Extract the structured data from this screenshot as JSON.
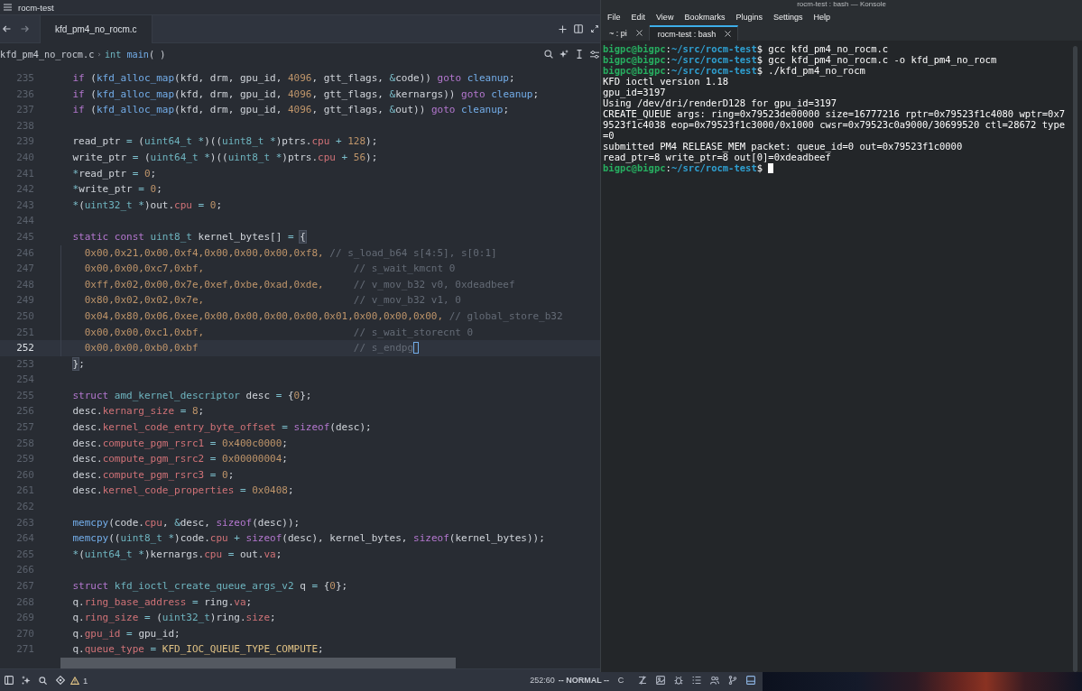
{
  "editor": {
    "title": "rocm-test",
    "tabs": [
      {
        "label": "kfd_pm4_no_rocm.c",
        "selected": true
      }
    ],
    "breadcrumb": {
      "file": "kfd_pm4_no_rocm.c",
      "separator": "›",
      "symbol": [
        {
          "kind": "type",
          "text": "int"
        },
        {
          "kind": "function",
          "text": " main"
        },
        {
          "kind": "plain",
          "text": "( )"
        }
      ]
    },
    "lines": [
      {
        "number": "235",
        "current": false,
        "tokens": [
          {
            "kind": "keyword",
            "text": "    if"
          },
          {
            "kind": "plain",
            "text": " ("
          },
          {
            "kind": "function",
            "text": "kfd_alloc_map"
          },
          {
            "kind": "plain",
            "text": "(kfd, drm, gpu_id, "
          },
          {
            "kind": "number",
            "text": "4096"
          },
          {
            "kind": "plain",
            "text": ", gtt_flags, "
          },
          {
            "kind": "operator",
            "text": "&"
          },
          {
            "kind": "plain",
            "text": "code)) "
          },
          {
            "kind": "keyword",
            "text": "goto"
          },
          {
            "kind": "function",
            "text": " cleanup"
          },
          {
            "kind": "plain",
            "text": ";"
          }
        ]
      },
      {
        "number": "236",
        "current": false,
        "tokens": [
          {
            "kind": "keyword",
            "text": "    if"
          },
          {
            "kind": "plain",
            "text": " ("
          },
          {
            "kind": "function",
            "text": "kfd_alloc_map"
          },
          {
            "kind": "plain",
            "text": "(kfd, drm, gpu_id, "
          },
          {
            "kind": "number",
            "text": "4096"
          },
          {
            "kind": "plain",
            "text": ", gtt_flags, "
          },
          {
            "kind": "operator",
            "text": "&"
          },
          {
            "kind": "plain",
            "text": "kernargs)) "
          },
          {
            "kind": "keyword",
            "text": "goto"
          },
          {
            "kind": "function",
            "text": " cleanup"
          },
          {
            "kind": "plain",
            "text": ";"
          }
        ]
      },
      {
        "number": "237",
        "current": false,
        "tokens": [
          {
            "kind": "keyword",
            "text": "    if"
          },
          {
            "kind": "plain",
            "text": " ("
          },
          {
            "kind": "function",
            "text": "kfd_alloc_map"
          },
          {
            "kind": "plain",
            "text": "(kfd, drm, gpu_id, "
          },
          {
            "kind": "number",
            "text": "4096"
          },
          {
            "kind": "plain",
            "text": ", gtt_flags, "
          },
          {
            "kind": "operator",
            "text": "&"
          },
          {
            "kind": "plain",
            "text": "out)) "
          },
          {
            "kind": "keyword",
            "text": "goto"
          },
          {
            "kind": "function",
            "text": " cleanup"
          },
          {
            "kind": "plain",
            "text": ";"
          }
        ]
      },
      {
        "number": "238",
        "current": false
      },
      {
        "number": "239",
        "current": false,
        "tokens": [
          {
            "kind": "plain",
            "text": "    read_ptr"
          },
          {
            "kind": "operator",
            "text": " = "
          },
          {
            "kind": "plain",
            "text": "("
          },
          {
            "kind": "type",
            "text": "uint64_t"
          },
          {
            "kind": "operator",
            "text": " *"
          },
          {
            "kind": "plain",
            "text": ")(("
          },
          {
            "kind": "type",
            "text": "uint8_t"
          },
          {
            "kind": "operator",
            "text": " *"
          },
          {
            "kind": "plain",
            "text": ")ptrs."
          },
          {
            "kind": "field",
            "text": "cpu"
          },
          {
            "kind": "operator",
            "text": " + "
          },
          {
            "kind": "number",
            "text": "128"
          },
          {
            "kind": "plain",
            "text": ");"
          }
        ]
      },
      {
        "number": "240",
        "current": false,
        "tokens": [
          {
            "kind": "plain",
            "text": "    write_ptr"
          },
          {
            "kind": "operator",
            "text": " = "
          },
          {
            "kind": "plain",
            "text": "("
          },
          {
            "kind": "type",
            "text": "uint64_t"
          },
          {
            "kind": "operator",
            "text": " *"
          },
          {
            "kind": "plain",
            "text": ")(("
          },
          {
            "kind": "type",
            "text": "uint8_t"
          },
          {
            "kind": "operator",
            "text": " *"
          },
          {
            "kind": "plain",
            "text": ")ptrs."
          },
          {
            "kind": "field",
            "text": "cpu"
          },
          {
            "kind": "operator",
            "text": " + "
          },
          {
            "kind": "number",
            "text": "56"
          },
          {
            "kind": "plain",
            "text": ");"
          }
        ]
      },
      {
        "number": "241",
        "current": false,
        "tokens": [
          {
            "kind": "operator",
            "text": "    *"
          },
          {
            "kind": "plain",
            "text": "read_ptr"
          },
          {
            "kind": "operator",
            "text": " = "
          },
          {
            "kind": "number",
            "text": "0"
          },
          {
            "kind": "plain",
            "text": ";"
          }
        ]
      },
      {
        "number": "242",
        "current": false,
        "tokens": [
          {
            "kind": "operator",
            "text": "    *"
          },
          {
            "kind": "plain",
            "text": "write_ptr"
          },
          {
            "kind": "operator",
            "text": " = "
          },
          {
            "kind": "number",
            "text": "0"
          },
          {
            "kind": "plain",
            "text": ";"
          }
        ]
      },
      {
        "number": "243",
        "current": false,
        "tokens": [
          {
            "kind": "operator",
            "text": "    *"
          },
          {
            "kind": "plain",
            "text": "("
          },
          {
            "kind": "type",
            "text": "uint32_t"
          },
          {
            "kind": "operator",
            "text": " *"
          },
          {
            "kind": "plain",
            "text": ")out."
          },
          {
            "kind": "field",
            "text": "cpu"
          },
          {
            "kind": "operator",
            "text": " = "
          },
          {
            "kind": "number",
            "text": "0"
          },
          {
            "kind": "plain",
            "text": ";"
          }
        ]
      },
      {
        "number": "244",
        "current": false
      },
      {
        "number": "245",
        "current": false,
        "tokens": [
          {
            "kind": "keyword",
            "text": "    static const"
          },
          {
            "kind": "type",
            "text": " uint8_t"
          },
          {
            "kind": "plain",
            "text": " kernel_bytes[]"
          },
          {
            "kind": "operator",
            "text": " = "
          },
          {
            "kind": "bracket",
            "text": "{"
          }
        ]
      },
      {
        "number": "246",
        "current": false,
        "tokens": [
          {
            "kind": "number",
            "text": "      0x00,0x21,0x00,0xf4,0x00,0x00,0x00,0xf8,"
          },
          {
            "kind": "comment",
            "text": " // s_load_b64 s[4:5], s[0:1]"
          }
        ]
      },
      {
        "number": "247",
        "current": false,
        "tokens": [
          {
            "kind": "number",
            "text": "      0x00,0x00,0xc7,0xbf,"
          },
          {
            "kind": "comment",
            "text": "                         // s_wait_kmcnt 0"
          }
        ]
      },
      {
        "number": "248",
        "current": false,
        "tokens": [
          {
            "kind": "number",
            "text": "      0xff,0x02,0x00,0x7e,0xef,0xbe,0xad,0xde,"
          },
          {
            "kind": "comment",
            "text": "     // v_mov_b32 v0, 0xdeadbeef"
          }
        ]
      },
      {
        "number": "249",
        "current": false,
        "tokens": [
          {
            "kind": "number",
            "text": "      0x80,0x02,0x02,0x7e,"
          },
          {
            "kind": "comment",
            "text": "                         // v_mov_b32 v1, 0"
          }
        ]
      },
      {
        "number": "250",
        "current": false,
        "tokens": [
          {
            "kind": "number",
            "text": "      0x04,0x80,0x06,0xee,0x00,0x00,0x00,0x00,0x01,0x00,0x00,0x00,"
          },
          {
            "kind": "comment",
            "text": " // global_store_b32"
          }
        ]
      },
      {
        "number": "251",
        "current": false,
        "tokens": [
          {
            "kind": "number",
            "text": "      0x00,0x00,0xc1,0xbf,"
          },
          {
            "kind": "comment",
            "text": "                         // s_wait_storecnt 0"
          }
        ]
      },
      {
        "number": "252",
        "current": true,
        "tokens": [
          {
            "kind": "number",
            "text": "      0x00,0x00,0xb0,0xbf"
          },
          {
            "kind": "comment",
            "text": "                          // s_endpg"
          }
        ]
      },
      {
        "number": "253",
        "current": false,
        "tokens": [
          {
            "kind": "bracket",
            "text": "    }"
          },
          {
            "kind": "plain",
            "text": ";"
          }
        ]
      },
      {
        "number": "254",
        "current": false
      },
      {
        "number": "255",
        "current": false,
        "tokens": [
          {
            "kind": "keyword",
            "text": "    struct"
          },
          {
            "kind": "type",
            "text": " amd_kernel_descriptor"
          },
          {
            "kind": "plain",
            "text": " desc"
          },
          {
            "kind": "operator",
            "text": " = "
          },
          {
            "kind": "plain",
            "text": "{"
          },
          {
            "kind": "number",
            "text": "0"
          },
          {
            "kind": "plain",
            "text": "};"
          }
        ]
      },
      {
        "number": "256",
        "current": false,
        "tokens": [
          {
            "kind": "plain",
            "text": "    desc."
          },
          {
            "kind": "field",
            "text": "kernarg_size"
          },
          {
            "kind": "operator",
            "text": " = "
          },
          {
            "kind": "number",
            "text": "8"
          },
          {
            "kind": "plain",
            "text": ";"
          }
        ]
      },
      {
        "number": "257",
        "current": false,
        "tokens": [
          {
            "kind": "plain",
            "text": "    desc."
          },
          {
            "kind": "field",
            "text": "kernel_code_entry_byte_offset"
          },
          {
            "kind": "operator",
            "text": " = "
          },
          {
            "kind": "keyword",
            "text": "sizeof"
          },
          {
            "kind": "plain",
            "text": "(desc);"
          }
        ]
      },
      {
        "number": "258",
        "current": false,
        "tokens": [
          {
            "kind": "plain",
            "text": "    desc."
          },
          {
            "kind": "field",
            "text": "compute_pgm_rsrc1"
          },
          {
            "kind": "operator",
            "text": " = "
          },
          {
            "kind": "number",
            "text": "0x400c0000"
          },
          {
            "kind": "plain",
            "text": ";"
          }
        ]
      },
      {
        "number": "259",
        "current": false,
        "tokens": [
          {
            "kind": "plain",
            "text": "    desc."
          },
          {
            "kind": "field",
            "text": "compute_pgm_rsrc2"
          },
          {
            "kind": "operator",
            "text": " = "
          },
          {
            "kind": "number",
            "text": "0x00000004"
          },
          {
            "kind": "plain",
            "text": ";"
          }
        ]
      },
      {
        "number": "260",
        "current": false,
        "tokens": [
          {
            "kind": "plain",
            "text": "    desc."
          },
          {
            "kind": "field",
            "text": "compute_pgm_rsrc3"
          },
          {
            "kind": "operator",
            "text": " = "
          },
          {
            "kind": "number",
            "text": "0"
          },
          {
            "kind": "plain",
            "text": ";"
          }
        ]
      },
      {
        "number": "261",
        "current": false,
        "tokens": [
          {
            "kind": "plain",
            "text": "    desc."
          },
          {
            "kind": "field",
            "text": "kernel_code_properties"
          },
          {
            "kind": "operator",
            "text": " = "
          },
          {
            "kind": "number",
            "text": "0x0408"
          },
          {
            "kind": "plain",
            "text": ";"
          }
        ]
      },
      {
        "number": "262",
        "current": false
      },
      {
        "number": "263",
        "current": false,
        "tokens": [
          {
            "kind": "function",
            "text": "    memcpy"
          },
          {
            "kind": "plain",
            "text": "(code."
          },
          {
            "kind": "field",
            "text": "cpu"
          },
          {
            "kind": "plain",
            "text": ", "
          },
          {
            "kind": "operator",
            "text": "&"
          },
          {
            "kind": "plain",
            "text": "desc, "
          },
          {
            "kind": "keyword",
            "text": "sizeof"
          },
          {
            "kind": "plain",
            "text": "(desc));"
          }
        ]
      },
      {
        "number": "264",
        "current": false,
        "tokens": [
          {
            "kind": "function",
            "text": "    memcpy"
          },
          {
            "kind": "plain",
            "text": "(("
          },
          {
            "kind": "type",
            "text": "uint8_t"
          },
          {
            "kind": "operator",
            "text": " *"
          },
          {
            "kind": "plain",
            "text": ")code."
          },
          {
            "kind": "field",
            "text": "cpu"
          },
          {
            "kind": "operator",
            "text": " + "
          },
          {
            "kind": "keyword",
            "text": "sizeof"
          },
          {
            "kind": "plain",
            "text": "(desc), kernel_bytes, "
          },
          {
            "kind": "keyword",
            "text": "sizeof"
          },
          {
            "kind": "plain",
            "text": "(kernel_bytes));"
          }
        ]
      },
      {
        "number": "265",
        "current": false,
        "tokens": [
          {
            "kind": "operator",
            "text": "    *"
          },
          {
            "kind": "plain",
            "text": "("
          },
          {
            "kind": "type",
            "text": "uint64_t"
          },
          {
            "kind": "operator",
            "text": " *"
          },
          {
            "kind": "plain",
            "text": ")kernargs."
          },
          {
            "kind": "field",
            "text": "cpu"
          },
          {
            "kind": "operator",
            "text": " = "
          },
          {
            "kind": "plain",
            "text": "out."
          },
          {
            "kind": "field",
            "text": "va"
          },
          {
            "kind": "plain",
            "text": ";"
          }
        ]
      },
      {
        "number": "266",
        "current": false
      },
      {
        "number": "267",
        "current": false,
        "tokens": [
          {
            "kind": "keyword",
            "text": "    struct"
          },
          {
            "kind": "type",
            "text": " kfd_ioctl_create_queue_args_v2"
          },
          {
            "kind": "plain",
            "text": " q"
          },
          {
            "kind": "operator",
            "text": " = "
          },
          {
            "kind": "plain",
            "text": "{"
          },
          {
            "kind": "number",
            "text": "0"
          },
          {
            "kind": "plain",
            "text": "};"
          }
        ]
      },
      {
        "number": "268",
        "current": false,
        "tokens": [
          {
            "kind": "plain",
            "text": "    q."
          },
          {
            "kind": "field",
            "text": "ring_base_address"
          },
          {
            "kind": "operator",
            "text": " = "
          },
          {
            "kind": "plain",
            "text": "ring."
          },
          {
            "kind": "field",
            "text": "va"
          },
          {
            "kind": "plain",
            "text": ";"
          }
        ]
      },
      {
        "number": "269",
        "current": false,
        "tokens": [
          {
            "kind": "plain",
            "text": "    q."
          },
          {
            "kind": "field",
            "text": "ring_size"
          },
          {
            "kind": "operator",
            "text": " = "
          },
          {
            "kind": "plain",
            "text": "("
          },
          {
            "kind": "type",
            "text": "uint32_t"
          },
          {
            "kind": "plain",
            "text": ")ring."
          },
          {
            "kind": "field",
            "text": "size"
          },
          {
            "kind": "plain",
            "text": ";"
          }
        ]
      },
      {
        "number": "270",
        "current": false,
        "tokens": [
          {
            "kind": "plain",
            "text": "    q."
          },
          {
            "kind": "field",
            "text": "gpu_id"
          },
          {
            "kind": "operator",
            "text": " = "
          },
          {
            "kind": "plain",
            "text": "gpu_id;"
          }
        ]
      },
      {
        "number": "271",
        "current": false,
        "tokens": [
          {
            "kind": "plain",
            "text": "    q."
          },
          {
            "kind": "field",
            "text": "queue_type"
          },
          {
            "kind": "operator",
            "text": " = "
          },
          {
            "kind": "constant",
            "text": "KFD_IOC_QUEUE_TYPE_COMPUTE"
          },
          {
            "kind": "plain",
            "text": ";"
          }
        ]
      }
    ],
    "status_bar": {
      "warnings": "1",
      "position": "252:60",
      "mode": "-- NORMAL --",
      "language": "C",
      "panel_buttons": [
        {
          "selected": false
        },
        {
          "selected": false
        },
        {
          "selected": false
        },
        {
          "selected": false
        },
        {
          "selected": false
        },
        {
          "selected": false
        },
        {
          "selected": true
        }
      ]
    }
  },
  "konsole": {
    "title": "rocm-test : bash — Konsole",
    "menu": [
      "File",
      "Edit",
      "View",
      "Bookmarks",
      "Plugins",
      "Settings",
      "Help"
    ],
    "tabs": [
      {
        "label": "~ : pi",
        "selected": false
      },
      {
        "label": "rocm-test : bash",
        "selected": true
      }
    ],
    "cursor": true,
    "lines": [
      {
        "segments": [
          {
            "kind": "user",
            "text": "bigpc@bigpc"
          },
          {
            "kind": "plain",
            "text": ":"
          },
          {
            "kind": "path",
            "text": "~/src/rocm-test"
          },
          {
            "kind": "plain",
            "text": "$ gcc kfd_pm4_no_rocm.c"
          }
        ]
      },
      {
        "segments": [
          {
            "kind": "user",
            "text": "bigpc@bigpc"
          },
          {
            "kind": "plain",
            "text": ":"
          },
          {
            "kind": "path",
            "text": "~/src/rocm-test"
          },
          {
            "kind": "plain",
            "text": "$ gcc kfd_pm4_no_rocm.c -o kfd_pm4_no_rocm"
          }
        ]
      },
      {
        "segments": [
          {
            "kind": "user",
            "text": "bigpc@bigpc"
          },
          {
            "kind": "plain",
            "text": ":"
          },
          {
            "kind": "path",
            "text": "~/src/rocm-test"
          },
          {
            "kind": "plain",
            "text": "$ ./kfd_pm4_no_rocm"
          }
        ]
      },
      {
        "segments": [
          {
            "kind": "plain",
            "text": "KFD ioctl version 1.18"
          }
        ]
      },
      {
        "segments": [
          {
            "kind": "plain",
            "text": "gpu_id=3197"
          }
        ]
      },
      {
        "segments": [
          {
            "kind": "plain",
            "text": "Using /dev/dri/renderD128 for gpu_id=3197"
          }
        ]
      },
      {
        "segments": [
          {
            "kind": "plain",
            "text": "CREATE_QUEUE args: ring=0x79523de00000 size=16777216 rptr=0x79523f1c4080 wptr=0x7"
          }
        ]
      },
      {
        "segments": [
          {
            "kind": "plain",
            "text": "9523f1c4038 eop=0x79523f1c3000/0x1000 cwsr=0x79523c0a9000/30699520 ctl=28672 type"
          }
        ]
      },
      {
        "segments": [
          {
            "kind": "plain",
            "text": "=0"
          }
        ]
      },
      {
        "segments": [
          {
            "kind": "plain",
            "text": "submitted PM4 RELEASE_MEM packet: queue_id=0 out=0x79523f1c0000"
          }
        ]
      },
      {
        "segments": [
          {
            "kind": "plain",
            "text": "read_ptr=8 write_ptr=8 out[0]=0xdeadbeef"
          }
        ]
      },
      {
        "segments": [
          {
            "kind": "user",
            "text": "bigpc@bigpc"
          },
          {
            "kind": "plain",
            "text": ":"
          },
          {
            "kind": "path",
            "text": "~/src/rocm-test"
          },
          {
            "kind": "plain",
            "text": "$"
          }
        ]
      }
    ]
  }
}
